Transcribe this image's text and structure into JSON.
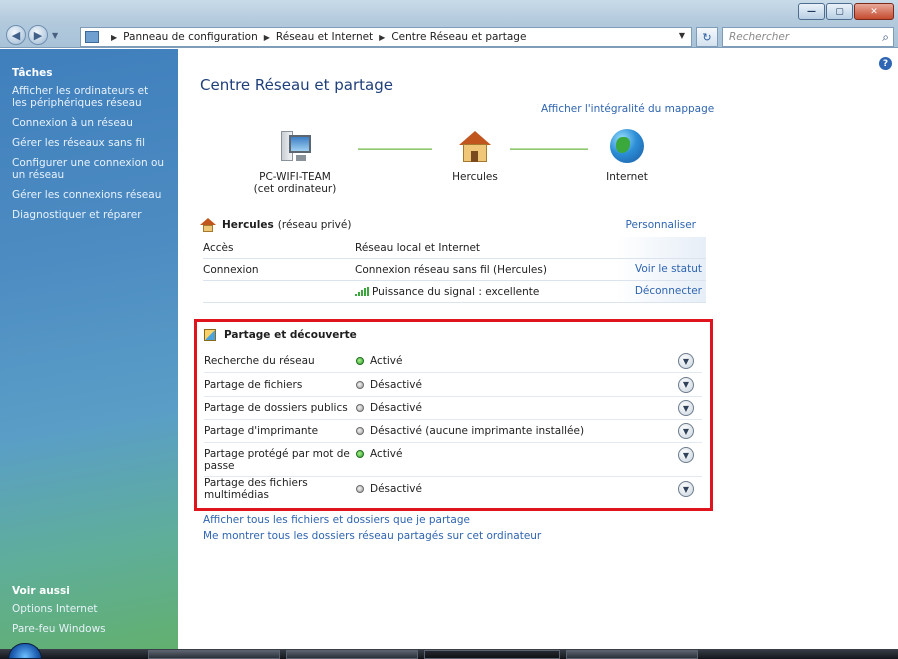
{
  "window": {
    "controls": {
      "minimize": "—",
      "maximize": "▢",
      "close": "✕"
    }
  },
  "address_bar": {
    "breadcrumbs": [
      "Panneau de configuration",
      "Réseau et Internet",
      "Centre Réseau et partage"
    ],
    "search_placeholder": "Rechercher"
  },
  "sidebar": {
    "title": "Tâches",
    "tasks": [
      "Afficher les ordinateurs et les périphériques réseau",
      "Connexion à un réseau",
      "Gérer les réseaux sans fil",
      "Configurer une connexion ou un réseau",
      "Gérer les connexions réseau",
      "Diagnostiquer et réparer"
    ],
    "see_also_title": "Voir aussi",
    "see_also": [
      "Options Internet",
      "Pare-feu Windows"
    ]
  },
  "main": {
    "title": "Centre Réseau et partage",
    "full_map_link": "Afficher l'intégralité du mappage",
    "map": {
      "computer": {
        "name": "PC-WIFI-TEAM",
        "sub": "(cet ordinateur)"
      },
      "network": {
        "name": "Hercules"
      },
      "internet": {
        "name": "Internet"
      }
    },
    "network": {
      "name": "Hercules",
      "type": "(réseau privé)",
      "customize": "Personnaliser",
      "rows": [
        {
          "label": "Accès",
          "value": "Réseau local et Internet",
          "action": ""
        },
        {
          "label": "Connexion",
          "value": "Connexion réseau sans fil (Hercules)",
          "action": "Voir le statut"
        },
        {
          "label": "",
          "value": "Puissance du signal : excellente",
          "action": "Déconnecter"
        }
      ]
    },
    "sharing": {
      "title": "Partage et découverte",
      "rows": [
        {
          "label": "Recherche du réseau",
          "status": "Activé",
          "on": true
        },
        {
          "label": "Partage de fichiers",
          "status": "Désactivé",
          "on": false
        },
        {
          "label": "Partage de dossiers publics",
          "status": "Désactivé",
          "on": false
        },
        {
          "label": "Partage d'imprimante",
          "status": "Désactivé (aucune imprimante installée)",
          "on": false
        },
        {
          "label": "Partage protégé par mot de passe",
          "status": "Activé",
          "on": true
        },
        {
          "label": "Partage des fichiers multimédias",
          "status": "Désactivé",
          "on": false
        }
      ]
    },
    "links": [
      "Afficher tous les fichiers et dossiers que je partage",
      "Me montrer tous les dossiers réseau partagés sur cet ordinateur"
    ]
  },
  "colors": {
    "link": "#2e64b0",
    "highlight_border": "#e0141d",
    "title": "#1e3f7a"
  }
}
